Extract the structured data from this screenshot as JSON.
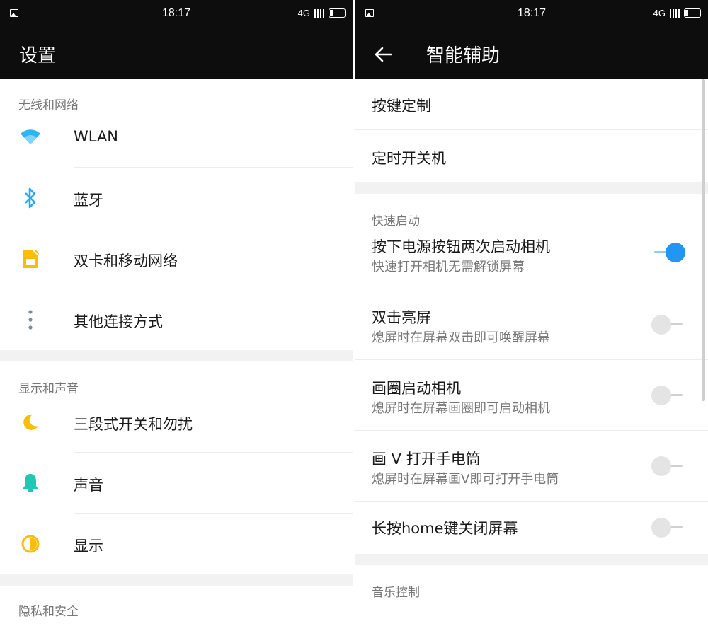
{
  "status_bar": {
    "time": "18:17",
    "network": "4G"
  },
  "left": {
    "title": "设置",
    "sections": [
      {
        "header": "无线和网络",
        "items": [
          {
            "label": "WLAN",
            "icon": "wifi-icon"
          },
          {
            "label": "蓝牙",
            "icon": "bluetooth-icon"
          },
          {
            "label": "双卡和移动网络",
            "icon": "sim-card-icon"
          },
          {
            "label": "其他连接方式",
            "icon": "more-vertical-icon"
          }
        ]
      },
      {
        "header": "显示和声音",
        "items": [
          {
            "label": "三段式开关和勿扰",
            "icon": "moon-icon"
          },
          {
            "label": "声音",
            "icon": "bell-icon"
          },
          {
            "label": "显示",
            "icon": "contrast-icon"
          }
        ]
      },
      {
        "header": "隐私和安全",
        "items": []
      }
    ]
  },
  "right": {
    "title": "智能辅助",
    "items_top": [
      {
        "label": "按键定制"
      },
      {
        "label": "定时开关机"
      }
    ],
    "quick_section": {
      "header": "快速启动",
      "items": [
        {
          "title": "按下电源按钮两次启动相机",
          "subtitle": "快速打开相机无需解锁屏幕",
          "on": true
        },
        {
          "title": "双击亮屏",
          "subtitle": "熄屏时在屏幕双击即可唤醒屏幕",
          "on": false
        },
        {
          "title": "画圈启动相机",
          "subtitle": "熄屏时在屏幕画圈即可启动相机",
          "on": false
        },
        {
          "title": "画 V 打开手电筒",
          "subtitle": "熄屏时在屏幕画V即可打开手电筒",
          "on": false
        },
        {
          "title": "长按home键关闭屏幕",
          "on": false
        }
      ]
    },
    "music_section": {
      "header": "音乐控制"
    }
  },
  "colors": {
    "accent": "#2196f3",
    "wifi": "#29b6f6",
    "yellow": "#fbbd08",
    "teal": "#1ec8b2",
    "bar": "#0d0d0d"
  }
}
